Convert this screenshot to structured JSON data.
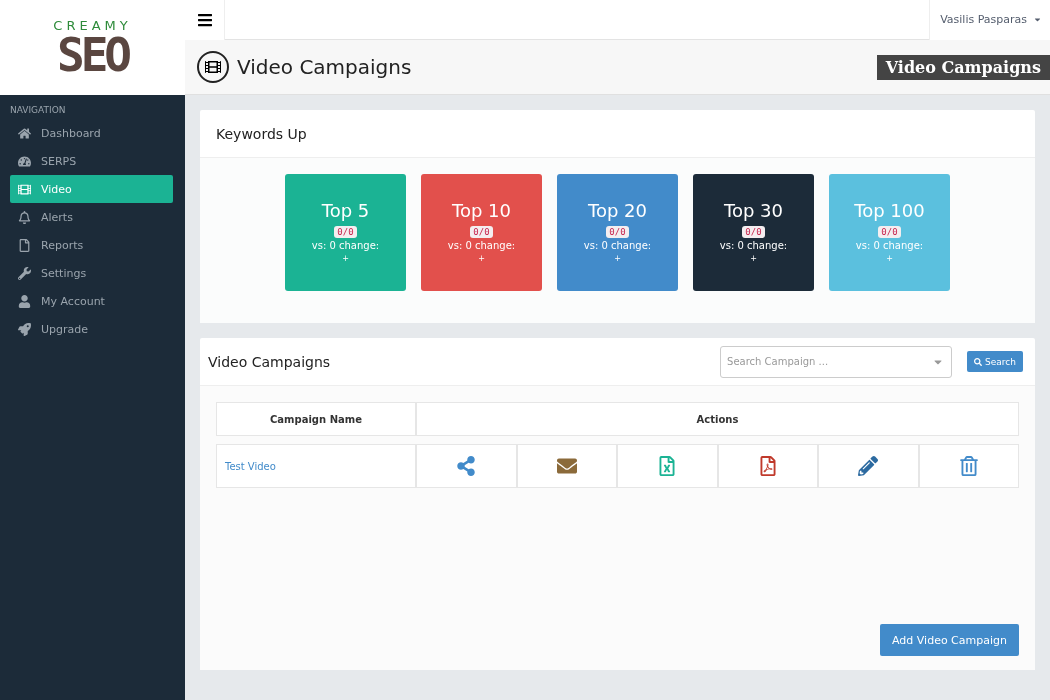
{
  "logo": {
    "top": "CREAMY",
    "main": "SEO"
  },
  "user": {
    "name": "Vasilis Pasparas"
  },
  "page": {
    "title": "Video Campaigns",
    "banner": "Video Campaigns"
  },
  "sidebar": {
    "heading": "NAVIGATION",
    "items": [
      {
        "label": "Dashboard",
        "selected": false
      },
      {
        "label": "SERPS",
        "selected": false
      },
      {
        "label": "Video",
        "selected": true
      },
      {
        "label": "Alerts",
        "selected": false
      },
      {
        "label": "Reports",
        "selected": false
      },
      {
        "label": "Settings",
        "selected": false
      },
      {
        "label": "My Account",
        "selected": false
      },
      {
        "label": "Upgrade",
        "selected": false
      }
    ]
  },
  "keywords": {
    "title": "Keywords Up",
    "cards": [
      {
        "title": "Top 5",
        "count": "0/0",
        "change": "vs: 0 change:",
        "mark": "+",
        "color": "#1bb394"
      },
      {
        "title": "Top 10",
        "count": "0/0",
        "change": "vs: 0 change:",
        "mark": "+",
        "color": "#e2504c"
      },
      {
        "title": "Top 20",
        "count": "0/0",
        "change": "vs: 0 change:",
        "mark": "+",
        "color": "#428bca"
      },
      {
        "title": "Top 30",
        "count": "0/0",
        "change": "vs: 0 change:",
        "mark": "+",
        "color": "#1c2b39"
      },
      {
        "title": "Top 100",
        "count": "0/0",
        "change": "vs: 0 change:",
        "mark": "+",
        "color": "#5bc0de"
      }
    ]
  },
  "campaigns": {
    "title": "Video Campaigns",
    "search": {
      "placeholder": "Search Campaign ..."
    },
    "search_button": "Search",
    "table": {
      "columns": [
        "Campaign Name",
        "Actions"
      ],
      "rows": [
        {
          "name": "Test Video"
        }
      ]
    },
    "add_button": "Add Video Campaign"
  }
}
